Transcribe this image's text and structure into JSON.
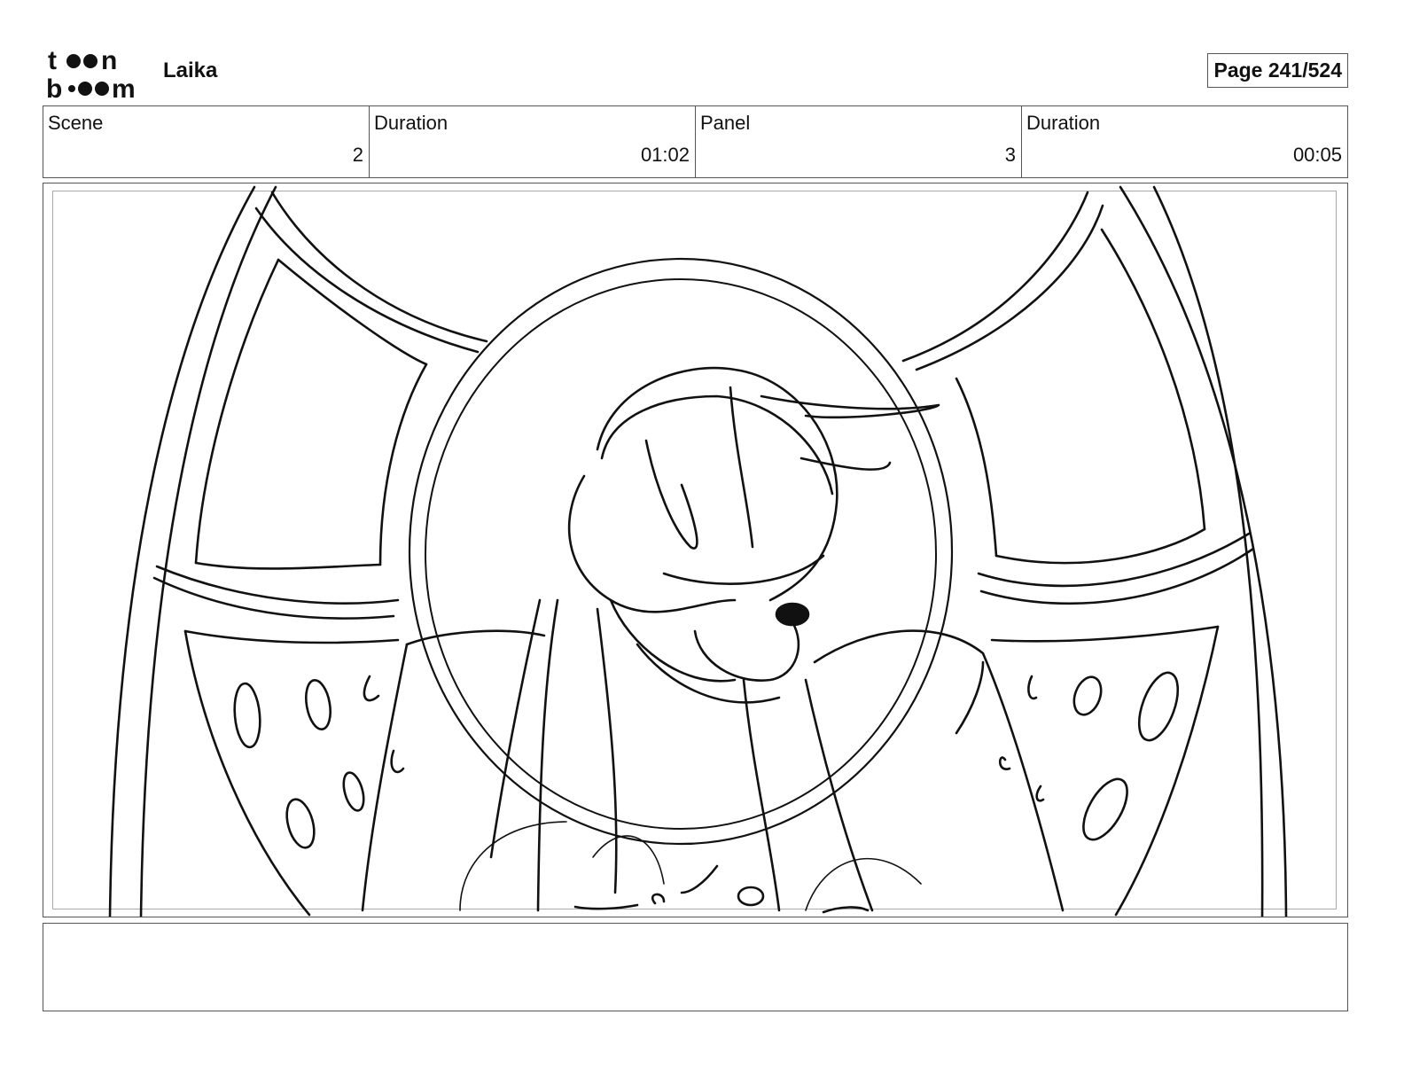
{
  "header": {
    "logo_text": "toon boom",
    "project_name": "Laika",
    "page_label": "Page 241/524"
  },
  "info": {
    "scene_label": "Scene",
    "scene_value": "2",
    "scene_duration_label": "Duration",
    "scene_duration_value": "01:02",
    "panel_label": "Panel",
    "panel_value": "3",
    "panel_duration_label": "Duration",
    "panel_duration_value": "00:05"
  },
  "panel": {
    "image_subject": "sketch-dog-in-porthole"
  },
  "notes": {
    "text": ""
  }
}
